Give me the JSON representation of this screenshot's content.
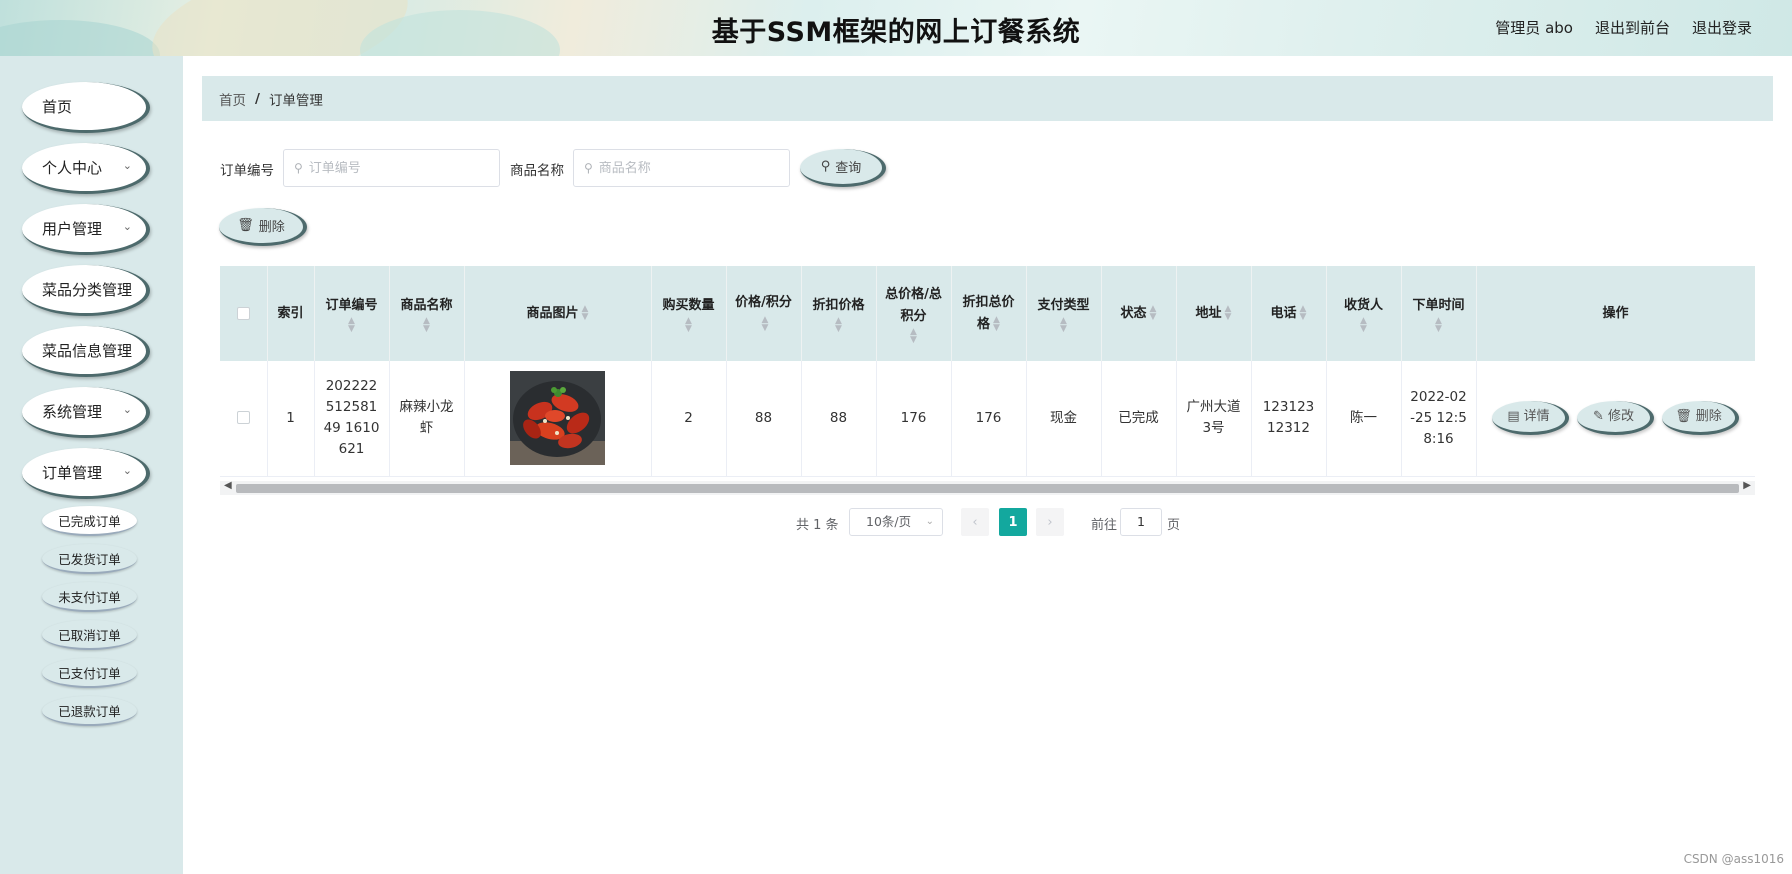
{
  "header": {
    "title": "基于SSM框架的网上订餐系统",
    "user": "管理员 abo",
    "to_front": "退出到前台",
    "logout": "退出登录"
  },
  "sidebar": {
    "items": [
      {
        "label": "首页",
        "has_children": false
      },
      {
        "label": "个人中心",
        "has_children": true
      },
      {
        "label": "用户管理",
        "has_children": true
      },
      {
        "label": "菜品分类管理",
        "has_children": false
      },
      {
        "label": "菜品信息管理",
        "has_children": false
      },
      {
        "label": "系统管理",
        "has_children": true
      },
      {
        "label": "订单管理",
        "has_children": true
      }
    ],
    "order_sub_items": [
      "已完成订单",
      "已发货订单",
      "未支付订单",
      "已取消订单",
      "已支付订单",
      "已退款订单"
    ],
    "active_sub_item": "已完成订单"
  },
  "breadcrumb": {
    "home": "首页",
    "separator": "/",
    "current": "订单管理"
  },
  "search": {
    "order_no_label": "订单编号",
    "order_no_placeholder": "订单编号",
    "goods_name_label": "商品名称",
    "goods_name_placeholder": "商品名称",
    "query_button": "查询",
    "delete_button": "删除"
  },
  "table": {
    "headers": {
      "index": "索引",
      "order_no": "订单编号",
      "goods_name": "商品名称",
      "goods_image": "商品图片",
      "quantity": "购买数量",
      "price": "价格/积分",
      "discount_price": "折扣价格",
      "total": "总价格/总积分",
      "discount_total": "折扣总价格",
      "pay_type": "支付类型",
      "status": "状态",
      "address": "地址",
      "phone": "电话",
      "receiver": "收货人",
      "order_time": "下单时间",
      "actions": "操作"
    },
    "row": {
      "index": "1",
      "order_no": "20222251258149 1610621",
      "goods_name": "麻辣小龙虾",
      "quantity": "2",
      "price": "88",
      "discount_price": "88",
      "total": "176",
      "discount_total": "176",
      "pay_type": "现金",
      "status": "已完成",
      "address": "广州大道3号",
      "phone": "12312312312",
      "receiver": "陈一",
      "order_time": "2022-02-25 12:58:16"
    },
    "row_actions": {
      "detail": "详情",
      "edit": "修改",
      "delete": "删除"
    }
  },
  "pagination": {
    "total": "共 1 条",
    "page_size": "10条/页",
    "current_page": "1",
    "goto_prefix": "前往",
    "goto_value": "1",
    "goto_suffix": "页"
  },
  "watermark": "CSDN @ass1016",
  "colors": {
    "sidebar_bg": "#d9e9ea",
    "accent": "#13a89e",
    "button_border": "#4d6a6c"
  }
}
